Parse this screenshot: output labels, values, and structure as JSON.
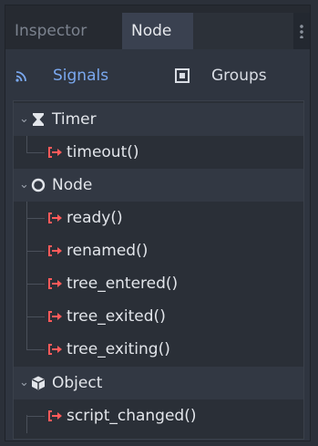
{
  "tabs": [
    {
      "label": "Inspector",
      "active": false
    },
    {
      "label": "Node",
      "active": true
    }
  ],
  "toolbar": {
    "signals_label": "Signals",
    "groups_label": "Groups",
    "signals_icon": "signal-wave-icon",
    "groups_icon": "group-square-icon",
    "signals_color": "#7aa8ef"
  },
  "tree": {
    "sections": [
      {
        "name": "Timer",
        "icon": "hourglass-icon",
        "signals": [
          "timeout()"
        ]
      },
      {
        "name": "Node",
        "icon": "circle-icon",
        "signals": [
          "ready()",
          "renamed()",
          "tree_entered()",
          "tree_exited()",
          "tree_exiting()"
        ]
      },
      {
        "name": "Object",
        "icon": "cube-icon",
        "signals": [
          "script_changed()"
        ]
      }
    ],
    "signal_icon": "signal-arrow-icon",
    "signal_icon_color": "#ff5a5a"
  }
}
